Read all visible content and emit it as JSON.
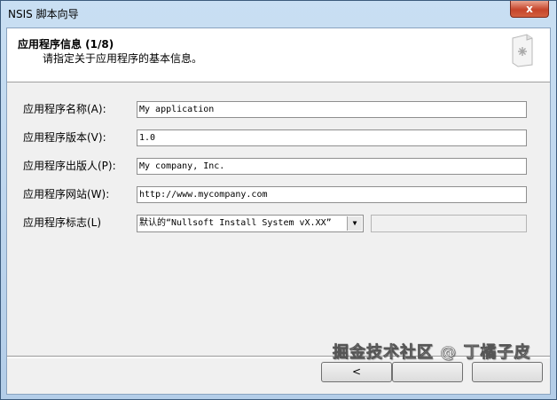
{
  "window": {
    "title": "NSIS 脚本向导",
    "close_label": "x"
  },
  "header": {
    "title": "应用程序信息 (1/8)",
    "subtitle": "请指定关于应用程序的基本信息。",
    "icon": "document-asterisk-icon"
  },
  "form": {
    "fields": [
      {
        "label": "应用程序名称(A):",
        "value": "My application"
      },
      {
        "label": "应用程序版本(V):",
        "value": "1.0"
      },
      {
        "label": "应用程序出版人(P):",
        "value": "My company, Inc."
      },
      {
        "label": "应用程序网站(W):",
        "value": "http://www.mycompany.com"
      }
    ],
    "icon_label": "应用程序标志(L)",
    "icon_selected": "默认的“Nullsoft Install System vX.XX”"
  },
  "footer": {
    "back_label": "<",
    "next_label": "",
    "cancel_label": "",
    "watermark": "掘金技术社区 @ 丁橘子皮"
  }
}
